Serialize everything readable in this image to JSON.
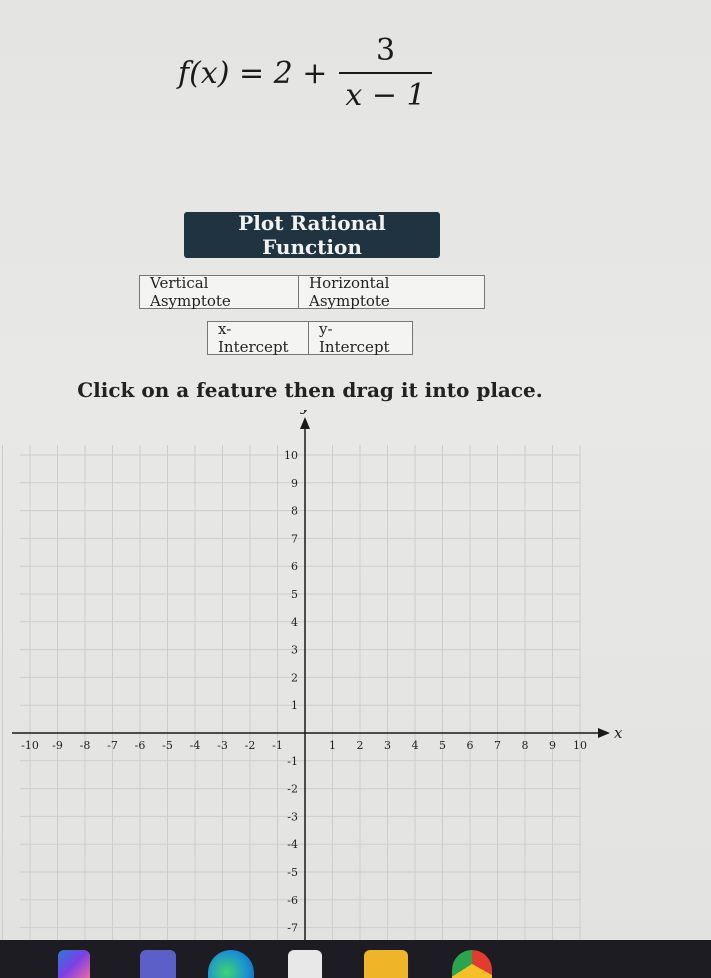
{
  "formula": {
    "lhs": "f(x) = 2 +",
    "numerator": "3",
    "denominator": "x − 1"
  },
  "buttons": {
    "plot": "Plot Rational Function"
  },
  "features": {
    "row1": [
      "Vertical Asymptote",
      "Horizontal Asymptote"
    ],
    "row2": [
      "x-Intercept",
      "y-Intercept"
    ]
  },
  "instruction": "Click on a feature then drag it into place.",
  "graph": {
    "x_label": "x",
    "y_label": "y",
    "x_ticks": [
      -10,
      -9,
      -8,
      -7,
      -6,
      -5,
      -4,
      -3,
      -2,
      -1,
      1,
      2,
      3,
      4,
      5,
      6,
      7,
      8,
      9,
      10
    ],
    "y_ticks": [
      10,
      9,
      8,
      7,
      6,
      5,
      4,
      3,
      2,
      1,
      -1,
      -2,
      -3,
      -4,
      -5,
      -6,
      -7
    ],
    "x_range": [
      -10,
      10
    ],
    "y_range": [
      -7,
      10
    ],
    "grid": true,
    "colors": {
      "grid": "#c9cfcf",
      "axis": "#1a1a1a"
    }
  },
  "taskbar": {
    "icons": [
      "copilot-icon",
      "teams-icon",
      "edge-icon",
      "store-icon",
      "file-explorer-icon",
      "chrome-icon"
    ],
    "colors": {
      "bar": "#1c1c22"
    }
  }
}
